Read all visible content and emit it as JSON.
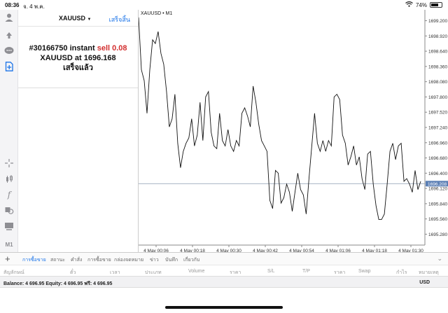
{
  "status": {
    "time": "08:36",
    "date": "จ. 4 พ.ค.",
    "battery": "74%",
    "battery_level": 0.74
  },
  "rail": {
    "icons": [
      "profile-icon",
      "trade-icon",
      "chat-icon",
      "new-document-icon",
      "crosshair-icon",
      "candles-icon",
      "function-icon",
      "objects-icon",
      "templates-icon",
      "timeframe-icon"
    ],
    "timeframe_label": "M1"
  },
  "panel": {
    "symbol": "XAUUSD",
    "symbol_caret": "▼",
    "done": "เสร็จสิ้น",
    "order_prefix": "#30166750 instant ",
    "order_side": "sell 0.08",
    "price_prefix": "XAUUSD at ",
    "price": "1696.168",
    "completed": "เสร็จแล้ว"
  },
  "chart_data": {
    "type": "line",
    "title": "XAUUSD • M1",
    "y_ticks": [
      "1699.200",
      "1698.920",
      "1698.640",
      "1698.360",
      "1698.080",
      "1697.800",
      "1697.520",
      "1697.240",
      "1696.960",
      "1696.680",
      "1696.400",
      "1696.120",
      "1695.840",
      "1695.560",
      "1695.280"
    ],
    "ylim": [
      1695.08,
      1699.4
    ],
    "x_ticks": [
      "4 May 00:06",
      "4 May 00:18",
      "4 May 00:30",
      "4 May 00:42",
      "4 May 00:54",
      "4 May 01:06",
      "4 May 01:18",
      "4 May 01:30"
    ],
    "current_price": "1696.208",
    "current_value": 1696.208,
    "values": [
      1699.26,
      1698.3,
      1698.1,
      1697.5,
      1698.3,
      1698.85,
      1698.78,
      1699.0,
      1698.6,
      1698.4,
      1697.9,
      1697.25,
      1697.4,
      1697.85,
      1696.95,
      1696.5,
      1696.8,
      1696.95,
      1697.05,
      1697.4,
      1696.9,
      1697.1,
      1697.7,
      1697.0,
      1697.8,
      1697.9,
      1697.15,
      1696.9,
      1696.85,
      1697.5,
      1697.0,
      1696.9,
      1697.2,
      1696.9,
      1696.8,
      1697.0,
      1696.9,
      1697.5,
      1697.6,
      1697.45,
      1697.25,
      1698.0,
      1697.7,
      1697.3,
      1697.0,
      1696.9,
      1696.8,
      1695.9,
      1695.75,
      1696.45,
      1696.4,
      1695.85,
      1695.95,
      1696.2,
      1696.05,
      1695.7,
      1696.05,
      1696.4,
      1696.1,
      1696.0,
      1695.65,
      1696.3,
      1696.9,
      1697.5,
      1696.95,
      1696.8,
      1697.0,
      1696.8,
      1697.0,
      1696.9,
      1697.8,
      1697.85,
      1697.75,
      1697.1,
      1696.95,
      1696.55,
      1696.7,
      1696.9,
      1696.55,
      1696.7,
      1696.3,
      1696.1,
      1696.75,
      1696.8,
      1696.2,
      1695.8,
      1695.55,
      1695.55,
      1695.65,
      1696.2,
      1696.8,
      1696.95,
      1696.65,
      1696.9,
      1696.95,
      1696.25,
      1696.3,
      1696.2,
      1696.05,
      1696.45,
      1696.1,
      1696.25
    ]
  },
  "tabs": [
    "การซื้อขาย",
    "สถานะ",
    "คำสั่ง",
    "การซื้อขาย",
    "กล่องจดหมาย",
    "ข่าว",
    "บันทึก",
    "เกี่ยวกับ"
  ],
  "columns": [
    "สัญลักษณ์",
    "ตั๋ว",
    "เวลา",
    "ประเภท",
    "Volume",
    "ราคา",
    "S/L",
    "T/P",
    "ราคา",
    "Swap",
    "กำไร",
    "หมายเหตุ"
  ],
  "balance": {
    "text": "Balance: 4 696.95 Equity: 4 696.95 ฟรี: 4 696.95",
    "currency": "USD"
  },
  "colors": {
    "accent": "#1a73e8",
    "sell": "#d32f2f",
    "price_tag": "#5b7fb5"
  }
}
